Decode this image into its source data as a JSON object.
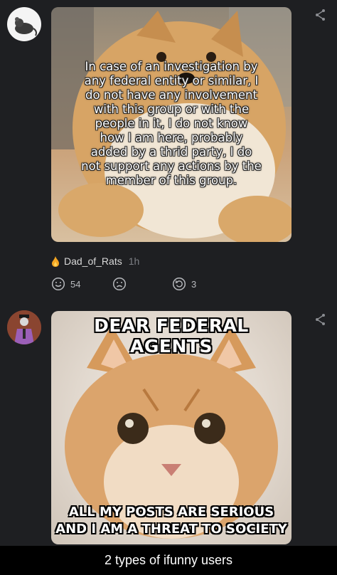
{
  "post1": {
    "meme_text": "In case of an investigation by\nany federal entity or similar, I\ndo not have any involvement\nwith this group or with the\npeople in it, I do not know\nhow I am here, probably\nadded by a thrid party, I do\nnot support any actions by the\nmember of this group.",
    "author": "Dad_of_Rats",
    "time": "1h",
    "smile_count": "54",
    "repost_count": "3"
  },
  "post2": {
    "top_text": "DEAR FEDERAL AGENTS",
    "bottom_line1": "ALL MY POSTS ARE SERIOUS",
    "bottom_line2": "AND I AM A THREAT TO SOCIETY"
  },
  "caption": "2 types of ifunny users",
  "colors": {
    "background": "#1e1f22",
    "flame": "#f5a623",
    "muted": "#7d7f85"
  }
}
